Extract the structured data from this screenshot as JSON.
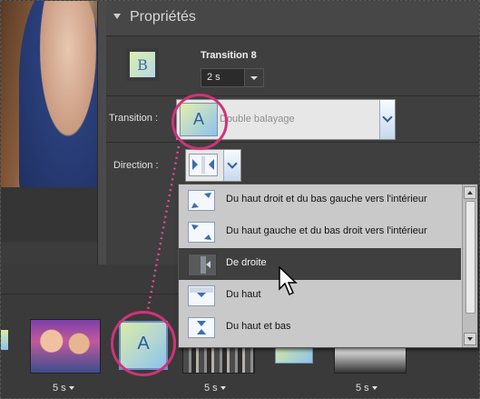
{
  "panel": {
    "title": "Propriétés"
  },
  "transition": {
    "name": "Transition 8",
    "duration": "2 s",
    "label": "Transition :",
    "selected": "Double balayage",
    "thumb_letter": "B",
    "icon_letter": "A"
  },
  "direction": {
    "label": "Direction :",
    "options": [
      "Du haut droit et du bas gauche vers l'intérieur",
      "Du haut gauche et du bas droit vers l'intérieur",
      "De droite",
      "Du haut",
      "Du haut et bas"
    ],
    "selected_index": 2
  },
  "timeline": {
    "clip_letter": "A",
    "durations": [
      "5 s",
      "5 s",
      "5 s"
    ]
  },
  "colors": {
    "highlight_ring": "#d1337a",
    "panel_bg": "#3f3f3f",
    "list_bg": "#c9c9c9"
  }
}
